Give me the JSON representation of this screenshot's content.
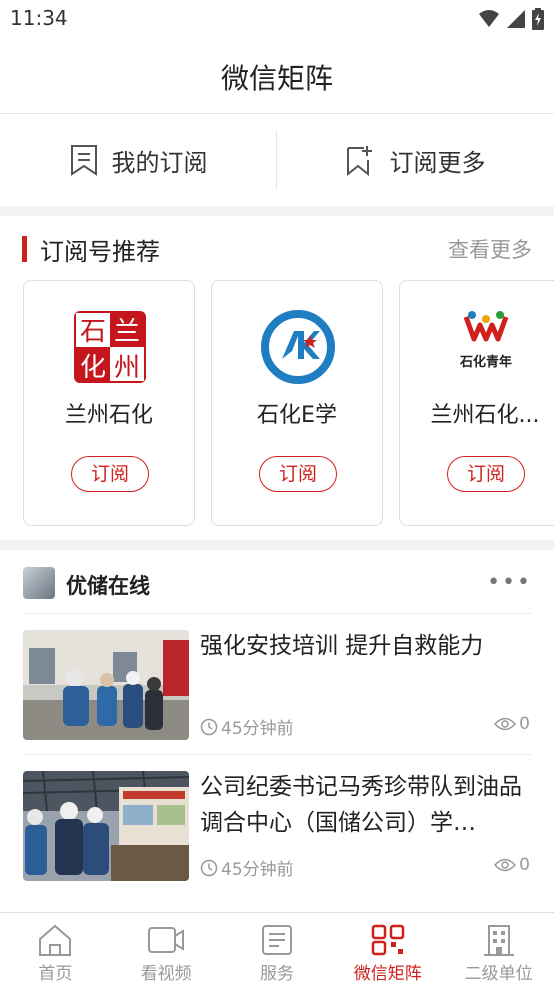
{
  "status_bar": {
    "time": "11:34"
  },
  "header": {
    "title": "微信矩阵"
  },
  "subscription": {
    "my_label": "我的订阅",
    "more_label": "订阅更多"
  },
  "recommend": {
    "title": "订阅号推荐",
    "more": "查看更多",
    "cards": [
      {
        "name": "兰州石化",
        "button": "订阅",
        "logo_text": [
          "兰",
          "州",
          "石",
          "化"
        ]
      },
      {
        "name": "石化E学",
        "button": "订阅"
      },
      {
        "name": "兰州石化...",
        "button": "订阅",
        "logo_text": "石化青年"
      }
    ]
  },
  "feed": {
    "account": "优储在线",
    "menu": "•••",
    "items": [
      {
        "title": "强化安技培训  提升自救能力",
        "time": "45分钟前",
        "views": "0"
      },
      {
        "title": "公司纪委书记马秀珍带队到油品调合中心（国储公司）学…",
        "time": "45分钟前",
        "views": "0"
      }
    ]
  },
  "tabs": [
    {
      "label": "首页",
      "icon": "home-icon",
      "active": false
    },
    {
      "label": "看视频",
      "icon": "video-icon",
      "active": false
    },
    {
      "label": "服务",
      "icon": "service-icon",
      "active": false
    },
    {
      "label": "微信矩阵",
      "icon": "qr-matrix-icon",
      "active": true
    },
    {
      "label": "二级单位",
      "icon": "building-icon",
      "active": false
    }
  ],
  "colors": {
    "accent": "#d0201d",
    "muted": "#999999"
  }
}
